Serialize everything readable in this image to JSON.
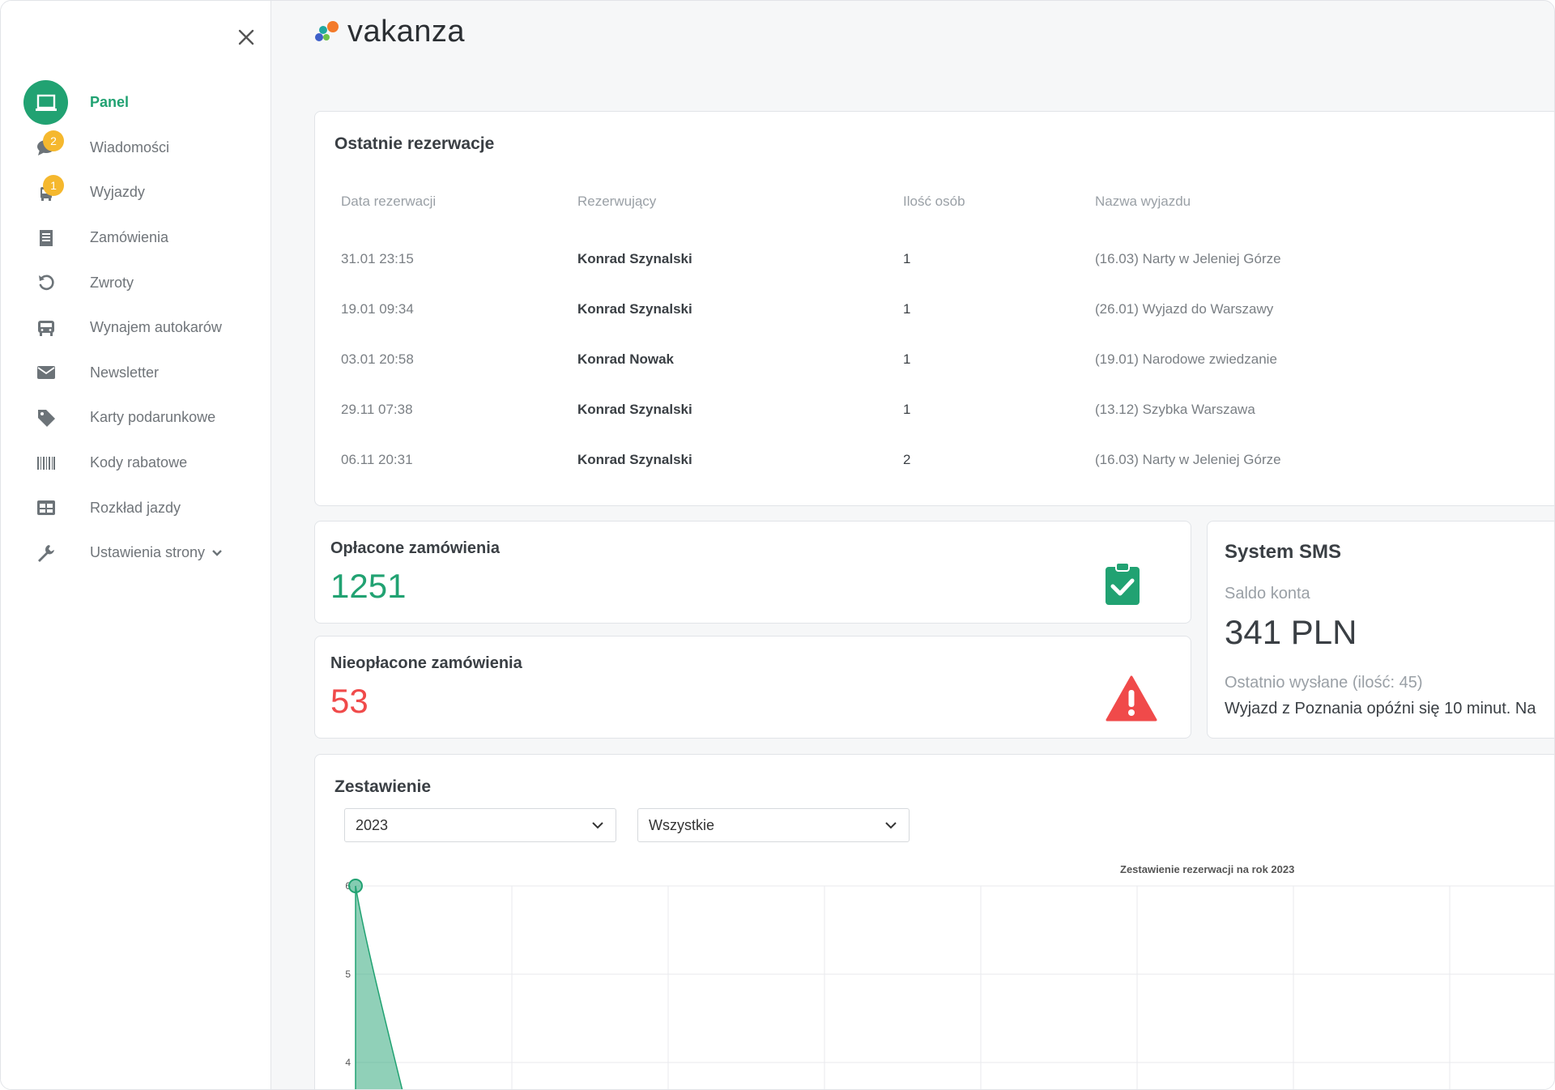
{
  "app": {
    "logo_text": "vakanza"
  },
  "sidebar": {
    "items": [
      {
        "label": "Panel",
        "icon": "laptop-icon",
        "active": true
      },
      {
        "label": "Wiadomości",
        "icon": "chat-icon",
        "badge": "2"
      },
      {
        "label": "Wyjazdy",
        "icon": "bus-front-icon",
        "badge": "1"
      },
      {
        "label": "Zamówienia",
        "icon": "receipt-icon"
      },
      {
        "label": "Zwroty",
        "icon": "undo-icon"
      },
      {
        "label": "Wynajem autokarów",
        "icon": "bus-icon"
      },
      {
        "label": "Newsletter",
        "icon": "envelope-icon"
      },
      {
        "label": "Karty podarunkowe",
        "icon": "tag-icon"
      },
      {
        "label": "Kody rabatowe",
        "icon": "barcode-icon"
      },
      {
        "label": "Rozkład jazdy",
        "icon": "table-icon"
      },
      {
        "label": "Ustawienia strony",
        "icon": "wrench-icon",
        "has_dropdown": true
      }
    ]
  },
  "reservations": {
    "title": "Ostatnie rezerwacje",
    "columns": [
      "Data rezerwacji",
      "Rezerwujący",
      "Ilość osób",
      "Nazwa wyjazdu"
    ],
    "rows": [
      {
        "date": "31.01 23:15",
        "name": "Konrad Szynalski",
        "qty": "1",
        "trip": "(16.03) Narty w Jeleniej Górze"
      },
      {
        "date": "19.01 09:34",
        "name": "Konrad Szynalski",
        "qty": "1",
        "trip": "(26.01) Wyjazd do Warszawy"
      },
      {
        "date": "03.01 20:58",
        "name": "Konrad Nowak",
        "qty": "1",
        "trip": "(19.01) Narodowe zwiedzanie"
      },
      {
        "date": "29.11 07:38",
        "name": "Konrad Szynalski",
        "qty": "1",
        "trip": "(13.12) Szybka Warszawa"
      },
      {
        "date": "06.11 20:31",
        "name": "Konrad Szynalski",
        "qty": "2",
        "trip": "(16.03) Narty w Jeleniej Górze"
      }
    ]
  },
  "paid": {
    "title": "Opłacone zamówienia",
    "value": "1251",
    "color": "#21a272",
    "icon": "clipboard-check-icon"
  },
  "unpaid": {
    "title": "Nieopłacone zamówienia",
    "value": "53",
    "color": "#f04a4a",
    "icon": "warning-icon"
  },
  "sms": {
    "title": "System SMS",
    "balance_label": "Saldo konta",
    "balance_value": "341 PLN",
    "last_sent_label": "Ostatnio wysłane (ilość: 45)",
    "last_message": "Wyjazd z Poznania opóźni się 10 minut. Na"
  },
  "summary": {
    "title": "Zestawienie",
    "year_select": "2023",
    "filter_select": "Wszystkie"
  },
  "chart_data": {
    "type": "area",
    "title": "Zestawienie rezerwacji na rok 2023",
    "yticks": [
      "6",
      "5",
      "4"
    ],
    "ylim_visible": [
      4,
      6
    ],
    "x_start_value": 6,
    "color": "#21a272",
    "grid": true
  }
}
